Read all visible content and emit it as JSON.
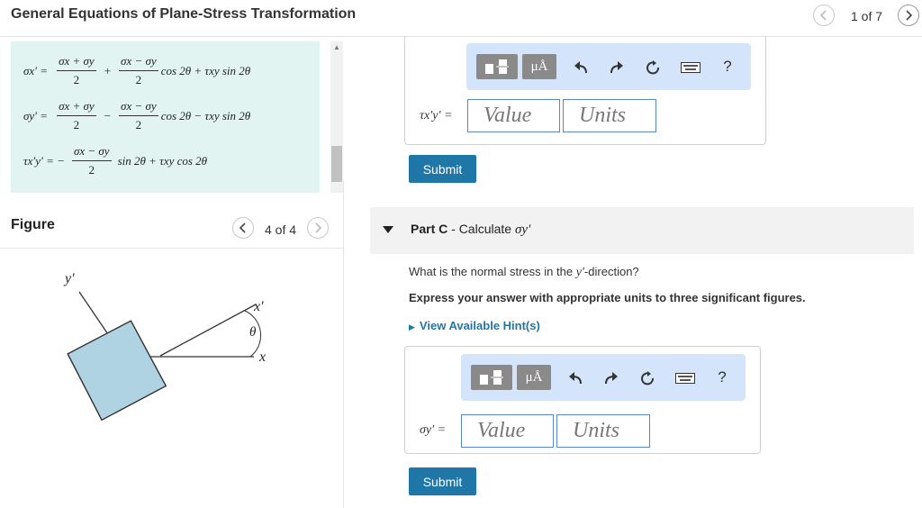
{
  "header": {
    "title": "General Equations of Plane-Stress Transformation",
    "pager": "1 of 7"
  },
  "equations": {
    "row1": {
      "lhs": "σx′ =",
      "num1": "σx + σy",
      "den1": "2",
      "op": "+",
      "num2": "σx − σy",
      "den2": "2",
      "trail": "cos 2θ + τxy sin 2θ"
    },
    "row2": {
      "lhs": "σy′ =",
      "num1": "σx + σy",
      "den1": "2",
      "op": "−",
      "num2": "σx − σy",
      "den2": "2",
      "trail": "cos 2θ − τxy sin 2θ"
    },
    "row3": {
      "lhs": "τx′y′ = −",
      "num1": "σx − σy",
      "den1": "2",
      "trail": "sin 2θ + τxy cos 2θ"
    }
  },
  "figure": {
    "label": "Figure",
    "pager": "4 of 4",
    "axis_y_prime": "y′",
    "axis_x_prime": "x′",
    "axis_x": "x",
    "angle": "θ"
  },
  "partB": {
    "field_label": "τx′y′ =",
    "value_placeholder": "Value",
    "units_placeholder": "Units",
    "submit_label": "Submit"
  },
  "partC": {
    "prefix": "Part C",
    "separator": " - ",
    "title_text": "Calculate ",
    "title_symbol": "σy′",
    "question_pre": "What is the normal stress in the ",
    "question_sym": "y′",
    "question_post": "-direction?",
    "instruction": "Express your answer with appropriate units to three significant figures.",
    "hint_link": "View Available Hint(s)",
    "field_label": "σy′ =",
    "value_placeholder": "Value",
    "units_placeholder": "Units",
    "submit_label": "Submit"
  },
  "toolbar": {
    "units_symbol": "μÅ",
    "help": "?"
  },
  "colors": {
    "accent": "#1f77a8",
    "toolbar_bg": "#d4e5fb",
    "equation_bg": "#e2f4f2",
    "element_fill": "#afd3e3"
  }
}
